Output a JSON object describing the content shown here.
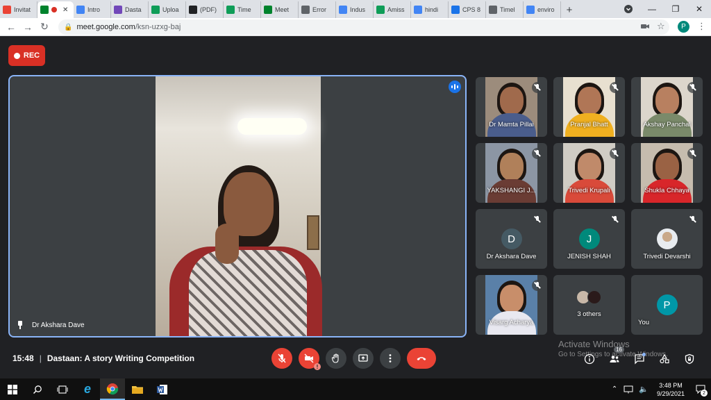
{
  "browser": {
    "tabs": [
      {
        "label": "Invitat",
        "icon": "gmail-icon",
        "color": "#ea4335"
      },
      {
        "label": "",
        "icon": "meet-icon",
        "color": "#00832d",
        "active": true
      },
      {
        "label": "Intro",
        "icon": "docs-icon",
        "color": "#4285f4"
      },
      {
        "label": "Dasta",
        "icon": "forms-icon",
        "color": "#7248b9"
      },
      {
        "label": "Uploa",
        "icon": "drive-icon",
        "color": "#0f9d58"
      },
      {
        "label": "(PDF)",
        "icon": "academia-icon",
        "color": "#202124"
      },
      {
        "label": "Time",
        "icon": "sheets-icon",
        "color": "#0f9d58"
      },
      {
        "label": "Meet",
        "icon": "meet-icon",
        "color": "#00832d"
      },
      {
        "label": "Error",
        "icon": "globe-icon",
        "color": "#5f6368"
      },
      {
        "label": "Indus",
        "icon": "calendar-icon",
        "color": "#4285f4"
      },
      {
        "label": "Amiss",
        "icon": "sheets-icon",
        "color": "#0f9d58"
      },
      {
        "label": "hindi",
        "icon": "google-icon",
        "color": "#4285f4"
      },
      {
        "label": "CPS 8",
        "icon": "classroom-icon",
        "color": "#1a73e8"
      },
      {
        "label": "Timel",
        "icon": "timeline-icon",
        "color": "#5f6368"
      },
      {
        "label": "enviro",
        "icon": "google-icon",
        "color": "#4285f4"
      }
    ],
    "new_tab": "+",
    "url_host": "meet.google.com",
    "url_path": "/ksn-uzxg-baj",
    "profile_letter": "P"
  },
  "meet": {
    "rec_label": "REC",
    "main_speaker": "Dr Akshara Dave",
    "participants": [
      {
        "name": "Dr Mamta Pillai",
        "type": "video"
      },
      {
        "name": "Pranjal Bhatt",
        "type": "video"
      },
      {
        "name": "Akshay Panchal",
        "type": "video"
      },
      {
        "name": "YAKSHANGI J...",
        "type": "video"
      },
      {
        "name": "Trivedi Krupali",
        "type": "video"
      },
      {
        "name": "Shukla Chhaya",
        "type": "video"
      },
      {
        "name": "Dr Akshara Dave",
        "type": "letter",
        "letter": "D",
        "color": "#455a64"
      },
      {
        "name": "JENISH SHAH",
        "type": "letter",
        "letter": "J",
        "color": "#00897b"
      },
      {
        "name": "Trivedi Devarshi",
        "type": "photo"
      },
      {
        "name": "Visarg Acharya",
        "type": "video"
      },
      {
        "name": "3 others",
        "type": "others"
      },
      {
        "name": "You",
        "type": "letter",
        "letter": "P",
        "color": "#0097a7"
      }
    ],
    "time": "15:48",
    "meeting_title": "Dastaan: A story Writing Competition",
    "people_count": "16",
    "watermark_line1": "Activate Windows",
    "watermark_line2": "Go to Settings to activate Windows."
  },
  "taskbar": {
    "time": "3:48 PM",
    "date": "9/29/2021",
    "notifications": "2"
  }
}
